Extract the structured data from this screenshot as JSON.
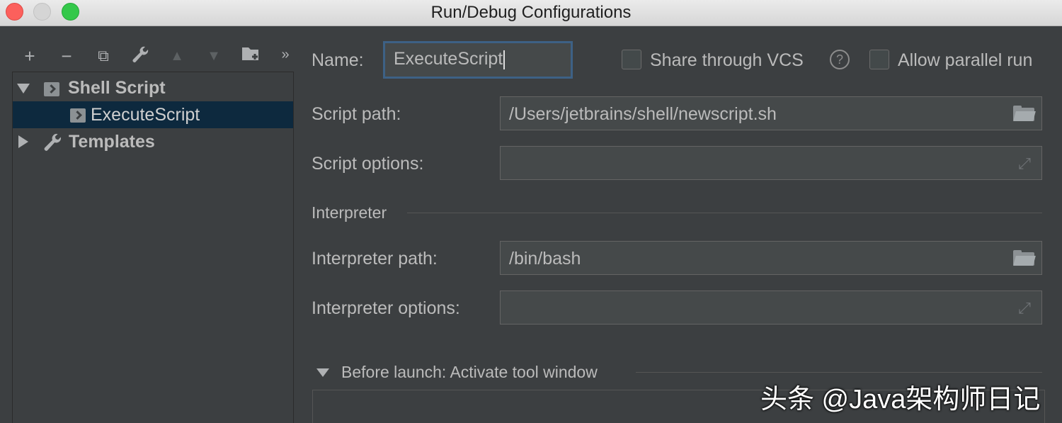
{
  "window": {
    "title": "Run/Debug Configurations"
  },
  "toolbar": {
    "add": "+",
    "remove": "−",
    "copy": "⧉",
    "edit": "🔧",
    "move_up": "▲",
    "move_down": "▼",
    "folder": "📁",
    "more": "»"
  },
  "tree": {
    "shell_script": "Shell Script",
    "execute_script": "ExecuteScript",
    "templates": "Templates"
  },
  "form": {
    "name_label": "Name:",
    "name_value": "ExecuteScript",
    "share_vcs_label": "Share through VCS",
    "allow_parallel_label": "Allow parallel run",
    "help_icon": "?",
    "script_path_label": "Script path:",
    "script_path_value": "/Users/jetbrains/shell/newscript.sh",
    "script_options_label": "Script options:",
    "script_options_value": "",
    "interpreter_section": "Interpreter",
    "interpreter_path_label": "Interpreter path:",
    "interpreter_path_value": "/bin/bash",
    "interpreter_options_label": "Interpreter options:",
    "interpreter_options_value": "",
    "before_launch_label": "Before launch: Activate tool window"
  },
  "watermark": "头条 @Java架构师日记",
  "colors": {
    "background": "#3c3f41",
    "selection": "#0d293e",
    "field": "#45494a",
    "focus_border": "#3d6185"
  }
}
